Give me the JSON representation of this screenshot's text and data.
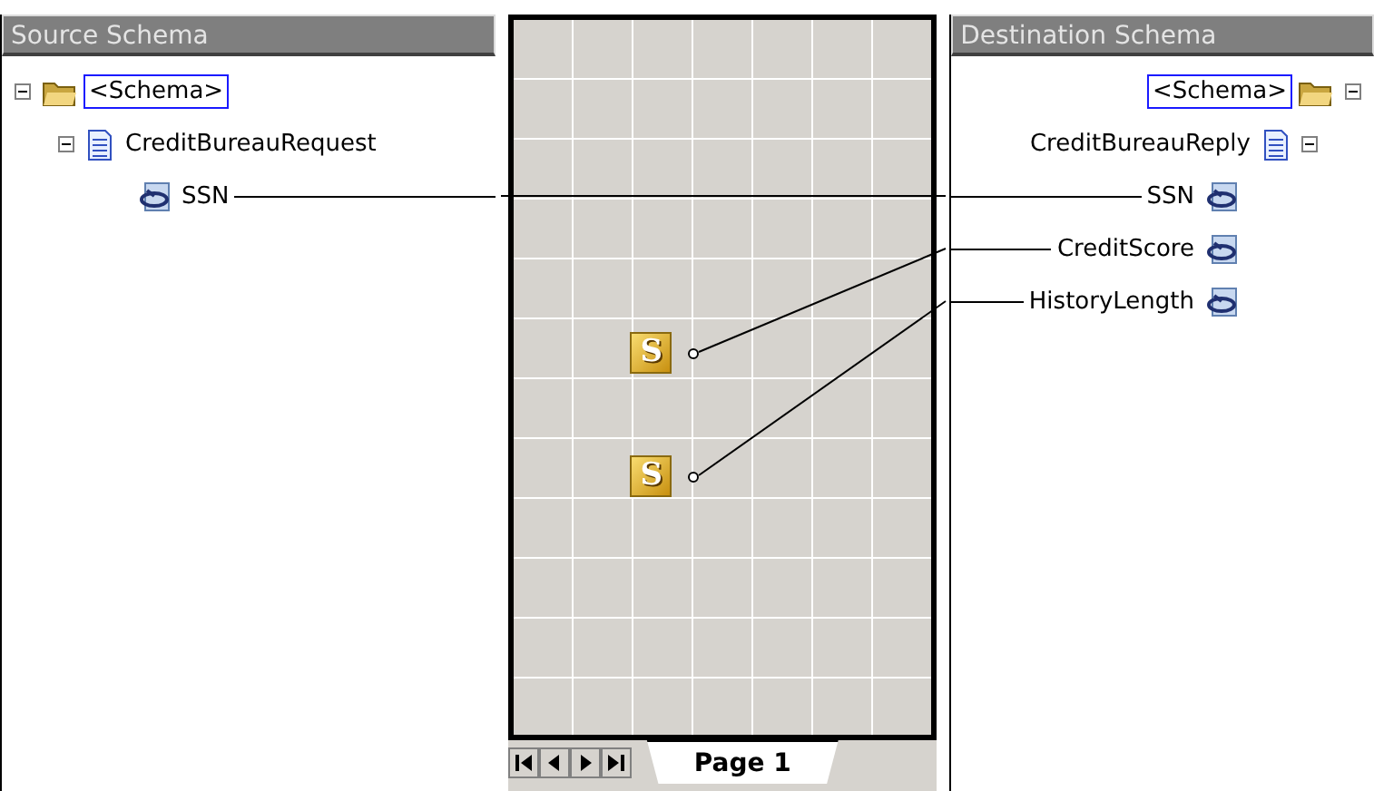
{
  "source_panel": {
    "title": "Source Schema",
    "tree": [
      {
        "label": "<Schema>",
        "kind": "root",
        "expanded": true,
        "selected": true,
        "children": [
          {
            "label": "CreditBureauRequest",
            "kind": "record",
            "expanded": true,
            "selected": false,
            "children": [
              {
                "label": "SSN",
                "kind": "field",
                "selected": false,
                "linked": true
              }
            ]
          }
        ]
      }
    ]
  },
  "grid": {
    "functoids": [
      {
        "label": "S"
      },
      {
        "label": "S"
      }
    ]
  },
  "pages": {
    "tabs": [
      {
        "label": "Page 1",
        "selected": true
      }
    ]
  },
  "destination_panel": {
    "title": "Destination Schema",
    "tree": [
      {
        "label": "<Schema>",
        "kind": "root",
        "expanded": true,
        "selected": true,
        "children": [
          {
            "label": "CreditBureauReply",
            "kind": "record",
            "expanded": true,
            "selected": false,
            "children": [
              {
                "label": "SSN",
                "kind": "field",
                "selected": false,
                "linked": true
              },
              {
                "label": "CreditScore",
                "kind": "field",
                "selected": false,
                "linked": true
              },
              {
                "label": "HistoryLength",
                "kind": "field",
                "selected": false,
                "linked": true
              }
            ]
          }
        ]
      }
    ]
  }
}
